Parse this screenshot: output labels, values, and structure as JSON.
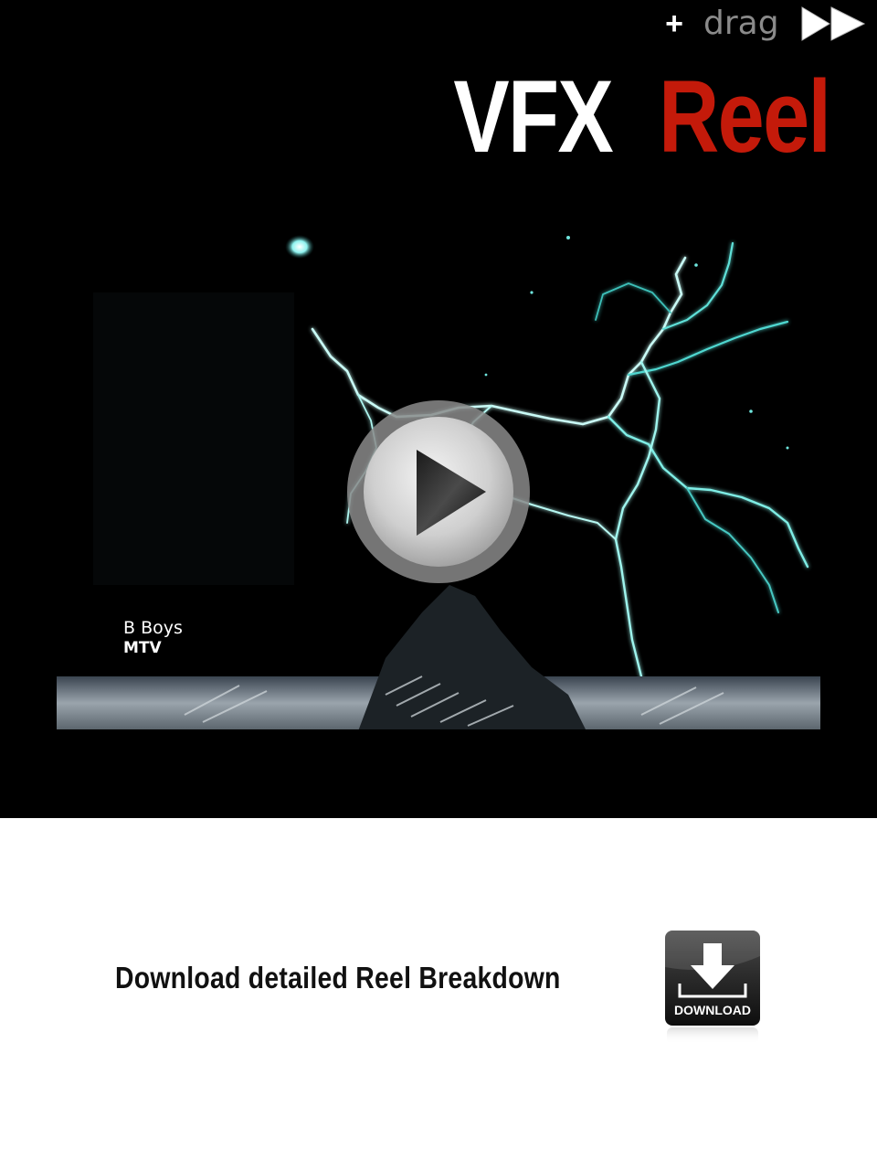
{
  "header": {
    "add_icon": "plus-icon",
    "drag_label": "drag",
    "forward_icon": "fast-forward-icon"
  },
  "title": {
    "part1": "VFX",
    "part2": "Reel",
    "accent_color": "#c41a0a"
  },
  "video": {
    "caption_line1": "B Boys",
    "caption_line2": "MTV",
    "play_icon": "play-icon"
  },
  "download": {
    "link_text": "Download detailed Reel Breakdown",
    "button_label": "DOWNLOAD",
    "button_icon": "download-arrow-icon"
  }
}
